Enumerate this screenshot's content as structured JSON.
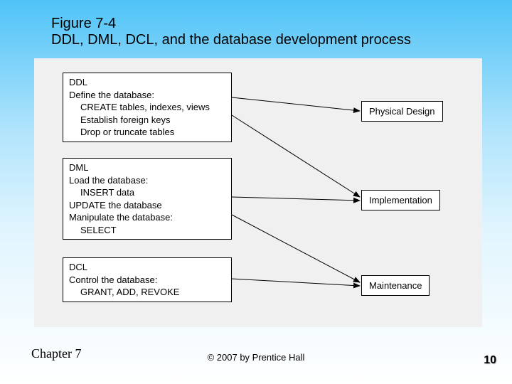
{
  "figure": {
    "number": "Figure 7-4",
    "title": "DDL, DML, DCL, and the database development process"
  },
  "boxes": {
    "ddl": {
      "header": "DDL",
      "line1": "Define the database:",
      "item1": "CREATE tables, indexes, views",
      "item2": "Establish foreign keys",
      "item3": "Drop or truncate tables"
    },
    "dml": {
      "header": "DML",
      "line1": "Load the database:",
      "item1": "INSERT data",
      "line2": "UPDATE the database",
      "line3": "Manipulate the database:",
      "item2": "SELECT"
    },
    "dcl": {
      "header": "DCL",
      "line1": "Control the database:",
      "item1": "GRANT, ADD, REVOKE"
    }
  },
  "phases": {
    "physical_design": "Physical Design",
    "implementation": "Implementation",
    "maintenance": "Maintenance"
  },
  "footer": {
    "chapter": "Chapter 7",
    "copyright": "© 2007 by Prentice Hall",
    "page": "10"
  },
  "chart_data": {
    "type": "diagram",
    "title": "DDL, DML, DCL, and the database development process",
    "left_nodes": [
      {
        "id": "DDL",
        "label": "Define the database: CREATE tables, indexes, views; Establish foreign keys; Drop or truncate tables"
      },
      {
        "id": "DML",
        "label": "Load the database: INSERT data; UPDATE the database; Manipulate the database: SELECT"
      },
      {
        "id": "DCL",
        "label": "Control the database: GRANT, ADD, REVOKE"
      }
    ],
    "right_nodes": [
      {
        "id": "Physical Design"
      },
      {
        "id": "Implementation"
      },
      {
        "id": "Maintenance"
      }
    ],
    "edges": [
      {
        "from": "DDL",
        "to": "Physical Design"
      },
      {
        "from": "DDL",
        "to": "Implementation"
      },
      {
        "from": "DML",
        "to": "Implementation"
      },
      {
        "from": "DML",
        "to": "Maintenance"
      },
      {
        "from": "DCL",
        "to": "Maintenance"
      }
    ]
  }
}
